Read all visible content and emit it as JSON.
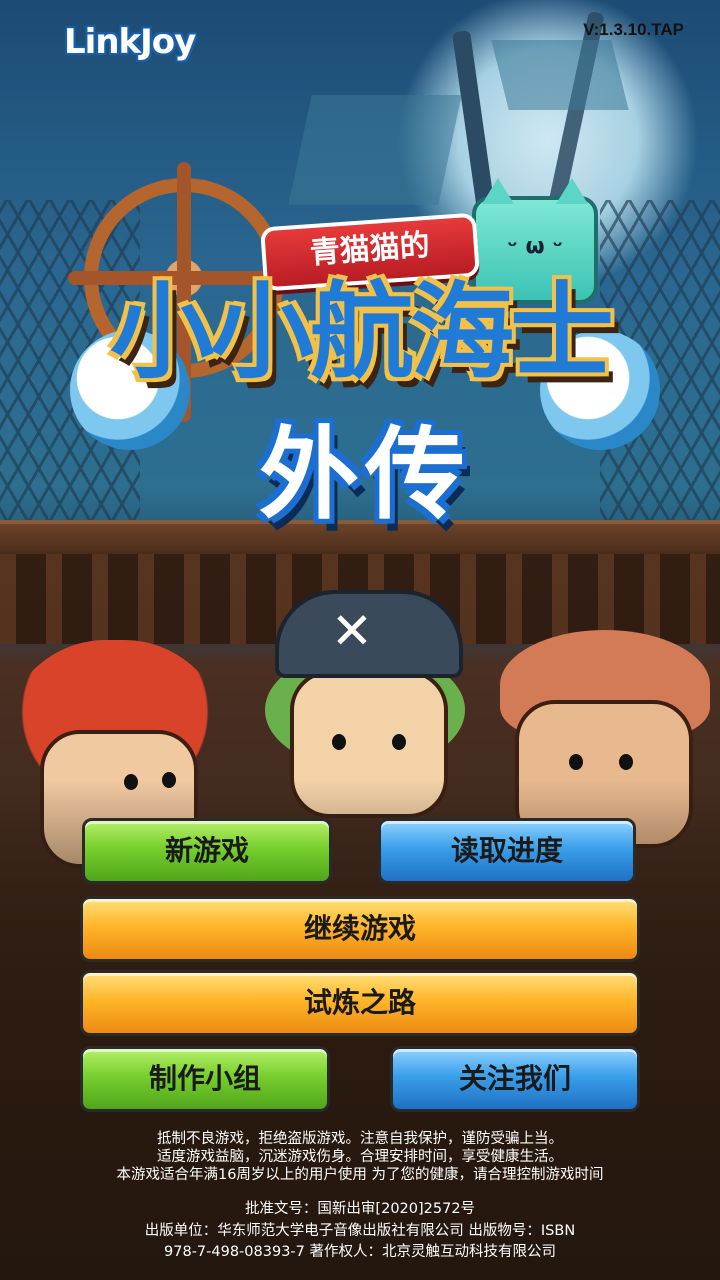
{
  "header": {
    "logo_text": "LinkJoy",
    "version": "V:1.3.10.TAP"
  },
  "title": {
    "subtitle": "青猫猫的",
    "main": "小小航海士",
    "sub": "外传"
  },
  "menu": {
    "new_game": "新游戏",
    "load_progress": "读取进度",
    "continue_game": "继续游戏",
    "trial_road": "试炼之路",
    "credits": "制作小组",
    "follow_us": "关注我们"
  },
  "notice": {
    "line1": "抵制不良游戏，拒绝盗版游戏。注意自我保护，谨防受骗上当。",
    "line2": "适度游戏益脑，沉迷游戏伤身。合理安排时间，享受健康生活。",
    "line3": "本游戏适合年满16周岁以上的用户使用 为了您的健康，请合理控制游戏时间"
  },
  "publication": {
    "approval": "批准文号：国新出审[2020]2572号",
    "publisher_line": "出版单位：华东师范大学电子音像出版社有限公司   出版物号：ISBN",
    "isbn_line": "978-7-498-08393-7   著作权人：北京灵触互动科技有限公司"
  },
  "colors": {
    "green_button": "#78cf2e",
    "blue_button": "#3a9fea",
    "orange_button": "#ffb62a",
    "title_blue": "#1f7bd6"
  }
}
